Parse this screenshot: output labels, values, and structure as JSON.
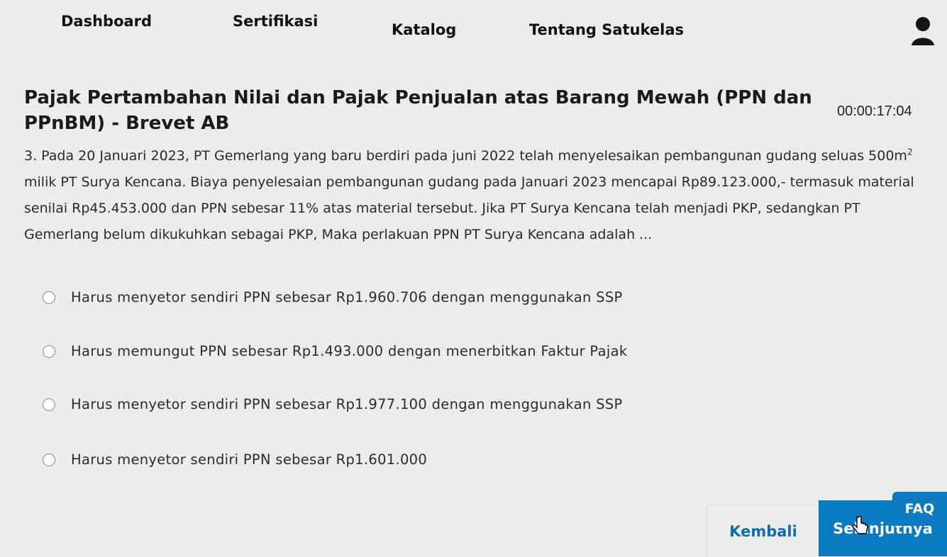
{
  "nav": {
    "dashboard": "Dashboard",
    "sertifikasi": "Sertifikasi",
    "katalog": "Katalog",
    "tentang": "Tentang Satukelas"
  },
  "header": {
    "avatar_icon": "user-silhouette-icon"
  },
  "quiz": {
    "title": "Pajak Pertambahan Nilai dan Pajak Penjualan atas Barang Mewah (PPN dan PPnBM) - Brevet AB",
    "timer": "00:00:17:04",
    "question_before_sup": "3. Pada 20 Januari 2023, PT Gemerlang yang baru berdiri pada juni 2022 telah menyelesaikan pembangunan gudang seluas 500m",
    "question_sup": "2",
    "question_after_sup": " milik PT Surya Kencana. Biaya penyelesaian pembangunan gudang pada Januari 2023 mencapai Rp89.123.000,- termasuk material senilai Rp45.453.000 dan PPN sebesar 11% atas material tersebut. Jika PT Surya Kencana telah menjadi PKP, sedangkan PT Gemerlang belum dikukuhkan sebagai PKP, Maka perlakuan PPN PT Surya Kencana adalah ...",
    "options": [
      "Harus menyetor sendiri PPN sebesar Rp1.960.706 dengan menggunakan SSP",
      "Harus memungut PPN sebesar Rp1.493.000 dengan menerbitkan Faktur Pajak",
      "Harus menyetor sendiri PPN sebesar Rp1.977.100 dengan menggunakan SSP",
      "Harus menyetor sendiri PPN sebesar Rp1.601.000"
    ]
  },
  "footer": {
    "back_label": "Kembali",
    "next_label": "Selanjutnya",
    "faq_label": "FAQ"
  },
  "colors": {
    "accent": "#0b7bc1",
    "link": "#0f6ea8",
    "background": "#ececea"
  }
}
